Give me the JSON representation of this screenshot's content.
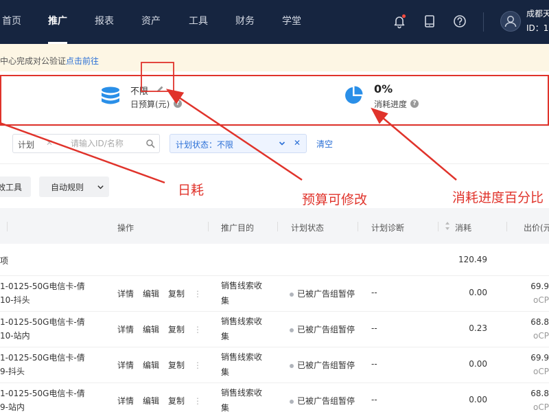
{
  "nav": {
    "items": [
      "首页",
      "推广",
      "报表",
      "资产",
      "工具",
      "财务",
      "学堂"
    ],
    "active": "推广",
    "company": "成都天",
    "user_id": "ID：1"
  },
  "notice": {
    "text": "中心完成对公验证",
    "link": "点击前往"
  },
  "stats": {
    "budget_value": "不限",
    "budget_label": "日预算(元)",
    "progress_value": "0%",
    "progress_label": "消耗进度"
  },
  "filters": {
    "plan_label": "计划",
    "plan_placeholder": "请输入ID/名称",
    "status_label": "计划状态：不限",
    "clear": "清空"
  },
  "toolbar": {
    "tool_btn": "效工具",
    "auto_rule_btn": "自动规则"
  },
  "table": {
    "columns": {
      "name": "",
      "ops": "操作",
      "purpose": "推广目的",
      "status": "计划状态",
      "diagnosis": "计划诊断",
      "spend": "消耗",
      "bid": "出价(元"
    },
    "summary": {
      "label": "项",
      "spend": "120.49"
    },
    "rows": [
      {
        "name1": "1-0125-50G电信卡-倩",
        "name2": "10-抖头",
        "op1": "详情",
        "op2": "编辑",
        "op3": "复制",
        "purpose1": "销售线索收",
        "purpose2": "集",
        "status": "已被广告组暂停",
        "diagnosis": "--",
        "spend": "0.00",
        "bid1": "69.9",
        "bid2": "oCP"
      },
      {
        "name1": "1-0125-50G电信卡-倩",
        "name2": "10-站内",
        "op1": "详情",
        "op2": "编辑",
        "op3": "复制",
        "purpose1": "销售线索收",
        "purpose2": "集",
        "status": "已被广告组暂停",
        "diagnosis": "--",
        "spend": "0.23",
        "bid1": "68.8",
        "bid2": "oCP"
      },
      {
        "name1": "1-0125-50G电信卡-倩",
        "name2": "9-抖头",
        "op1": "详情",
        "op2": "编辑",
        "op3": "复制",
        "purpose1": "销售线索收",
        "purpose2": "集",
        "status": "已被广告组暂停",
        "diagnosis": "--",
        "spend": "0.00",
        "bid1": "69.9",
        "bid2": "oCP"
      },
      {
        "name1": "1-0125-50G电信卡-倩",
        "name2": "9-站内",
        "op1": "详情",
        "op2": "编辑",
        "op3": "复制",
        "purpose1": "销售线索收",
        "purpose2": "集",
        "status": "已被广告组暂停",
        "diagnosis": "--",
        "spend": "0.00",
        "bid1": "68.8",
        "bid2": "oCP"
      }
    ]
  },
  "annotations": {
    "daily": "日耗",
    "budget": "预算可修改",
    "progress": "消耗进度百分比",
    "color": "#e0332b"
  },
  "colors": {
    "nav_bg": "#162540",
    "link": "#2a6fd6",
    "notice_bg": "#fdf6e4",
    "accent_blue": "#2a8fe8"
  }
}
